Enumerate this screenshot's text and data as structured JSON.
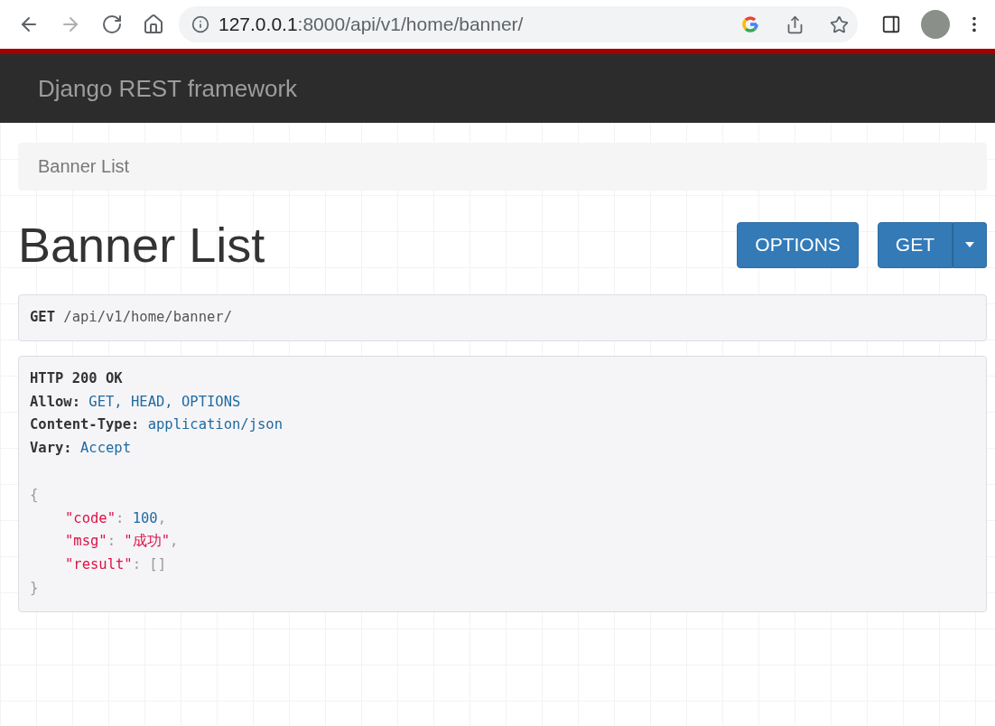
{
  "browser": {
    "nav": [
      {
        "kind": "back",
        "disabled": false
      },
      {
        "kind": "forward",
        "disabled": true
      },
      {
        "kind": "reload",
        "disabled": false
      },
      {
        "kind": "home",
        "disabled": false
      }
    ],
    "url_host": "127.0.0.1",
    "url_rest": ":8000/api/v1/home/banner/"
  },
  "navbar": {
    "brand": "Django REST framework"
  },
  "breadcrumb": [
    "Banner List"
  ],
  "page_title": "Banner List",
  "buttons": [
    {
      "label": "OPTIONS",
      "kind": "plain"
    },
    {
      "label": "GET",
      "kind": "split"
    }
  ],
  "request": {
    "method": "GET",
    "path": "/api/v1/home/banner/"
  },
  "response": {
    "status": "HTTP 200 OK",
    "headers": [
      {
        "name": "Allow:",
        "value": "GET, HEAD, OPTIONS"
      },
      {
        "name": "Content-Type:",
        "value": "application/json"
      },
      {
        "name": "Vary:",
        "value": "Accept"
      }
    ],
    "open": "{",
    "entries": [
      {
        "key": "\"code\"",
        "colon": ":",
        "value": "100",
        "kind": "number",
        "comma": ","
      },
      {
        "key": "\"msg\"",
        "colon": ":",
        "value": "\"成功\"",
        "kind": "string",
        "comma": ","
      },
      {
        "key": "\"result\"",
        "colon": ":",
        "value": "[]",
        "kind": "empty"
      }
    ],
    "close": "}"
  }
}
